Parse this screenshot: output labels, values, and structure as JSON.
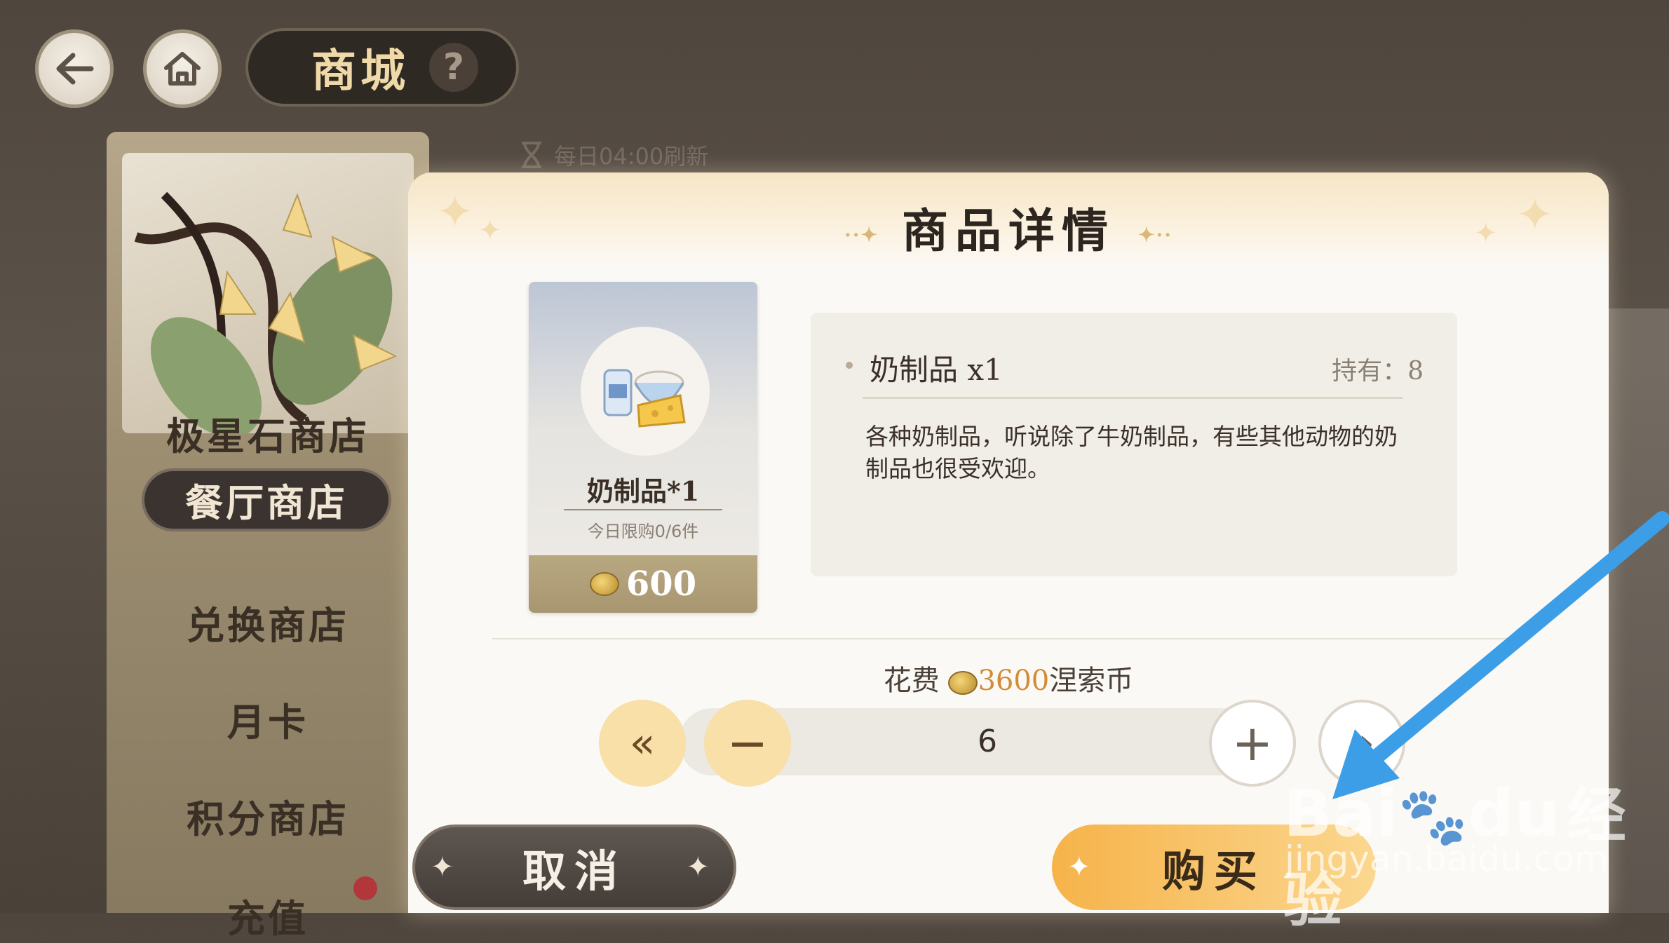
{
  "header": {
    "title": "商城",
    "help": "?",
    "refresh_note": "每日04:00刷新"
  },
  "sidebar": {
    "items": [
      {
        "label": "极星石商店"
      },
      {
        "label": "餐厅商店",
        "active": true
      },
      {
        "label": "兑换商店"
      },
      {
        "label": "月卡"
      },
      {
        "label": "积分商店"
      },
      {
        "label": "充值"
      }
    ]
  },
  "dialog": {
    "title": "商品详情",
    "card": {
      "name": "奶制品*1",
      "limit": "今日限购0/6件",
      "price": "600"
    },
    "info": {
      "name": "奶制品 x1",
      "owned": "持有：8",
      "description": "各种奶制品，听说除了牛奶制品，有些其他动物的奶制品也很受欢迎。"
    },
    "cost": {
      "prefix": "花费",
      "amount": "3600",
      "currency": "涅索币"
    },
    "quantity": "6",
    "cancel_label": "取消",
    "buy_label": "购买"
  },
  "watermark": {
    "brand": "Bai",
    "brand2": "du",
    "brand_cn": "经验",
    "url": "jingyan.baidu.com"
  },
  "colors": {
    "accent_orange": "#d38b34",
    "arrow_blue": "#3d9ee8",
    "buy_button": "#f6b34a"
  }
}
